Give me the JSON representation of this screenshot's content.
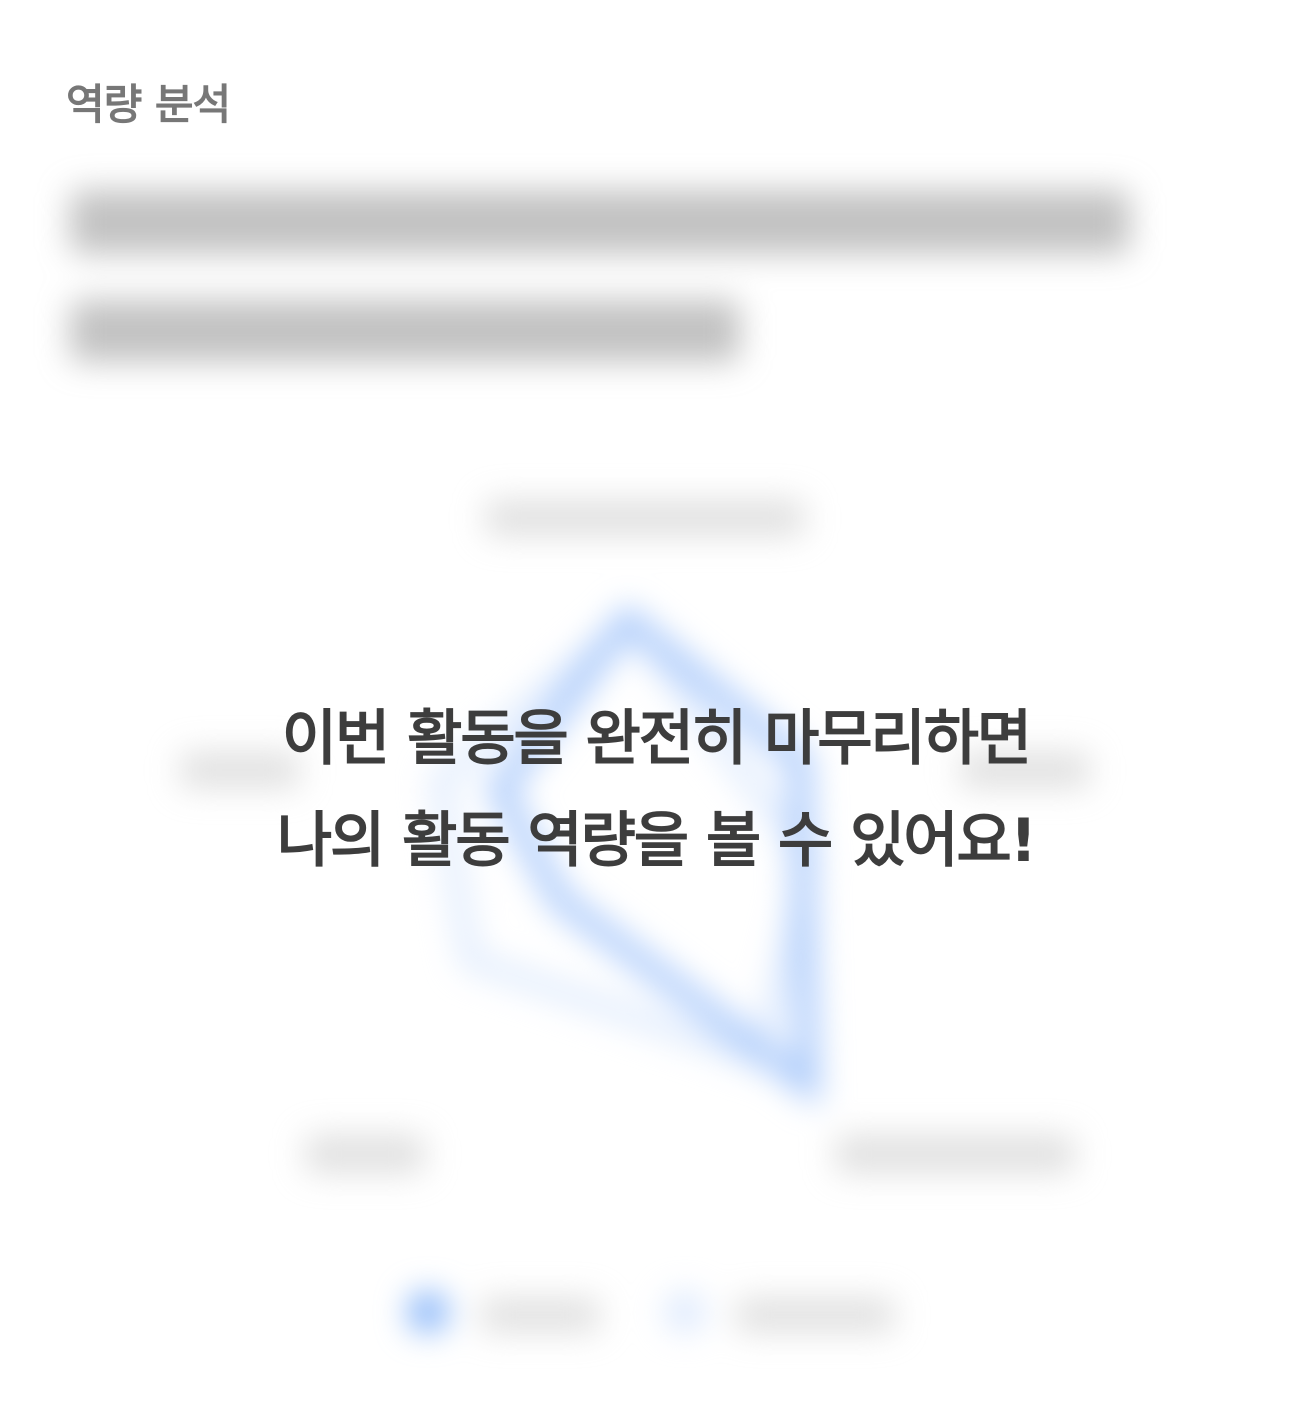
{
  "section": {
    "label": "역량 분석"
  },
  "lock_message": {
    "line1": "이번 활동을 완전히 마무리하면",
    "line2": "나의 활동 역량을 볼 수 있어요!"
  },
  "colors": {
    "accent_blue": "#4c8cf5",
    "accent_blue_light": "#b9d3fc",
    "label_gray": "#777777",
    "message_text": "#3d3d3d"
  }
}
